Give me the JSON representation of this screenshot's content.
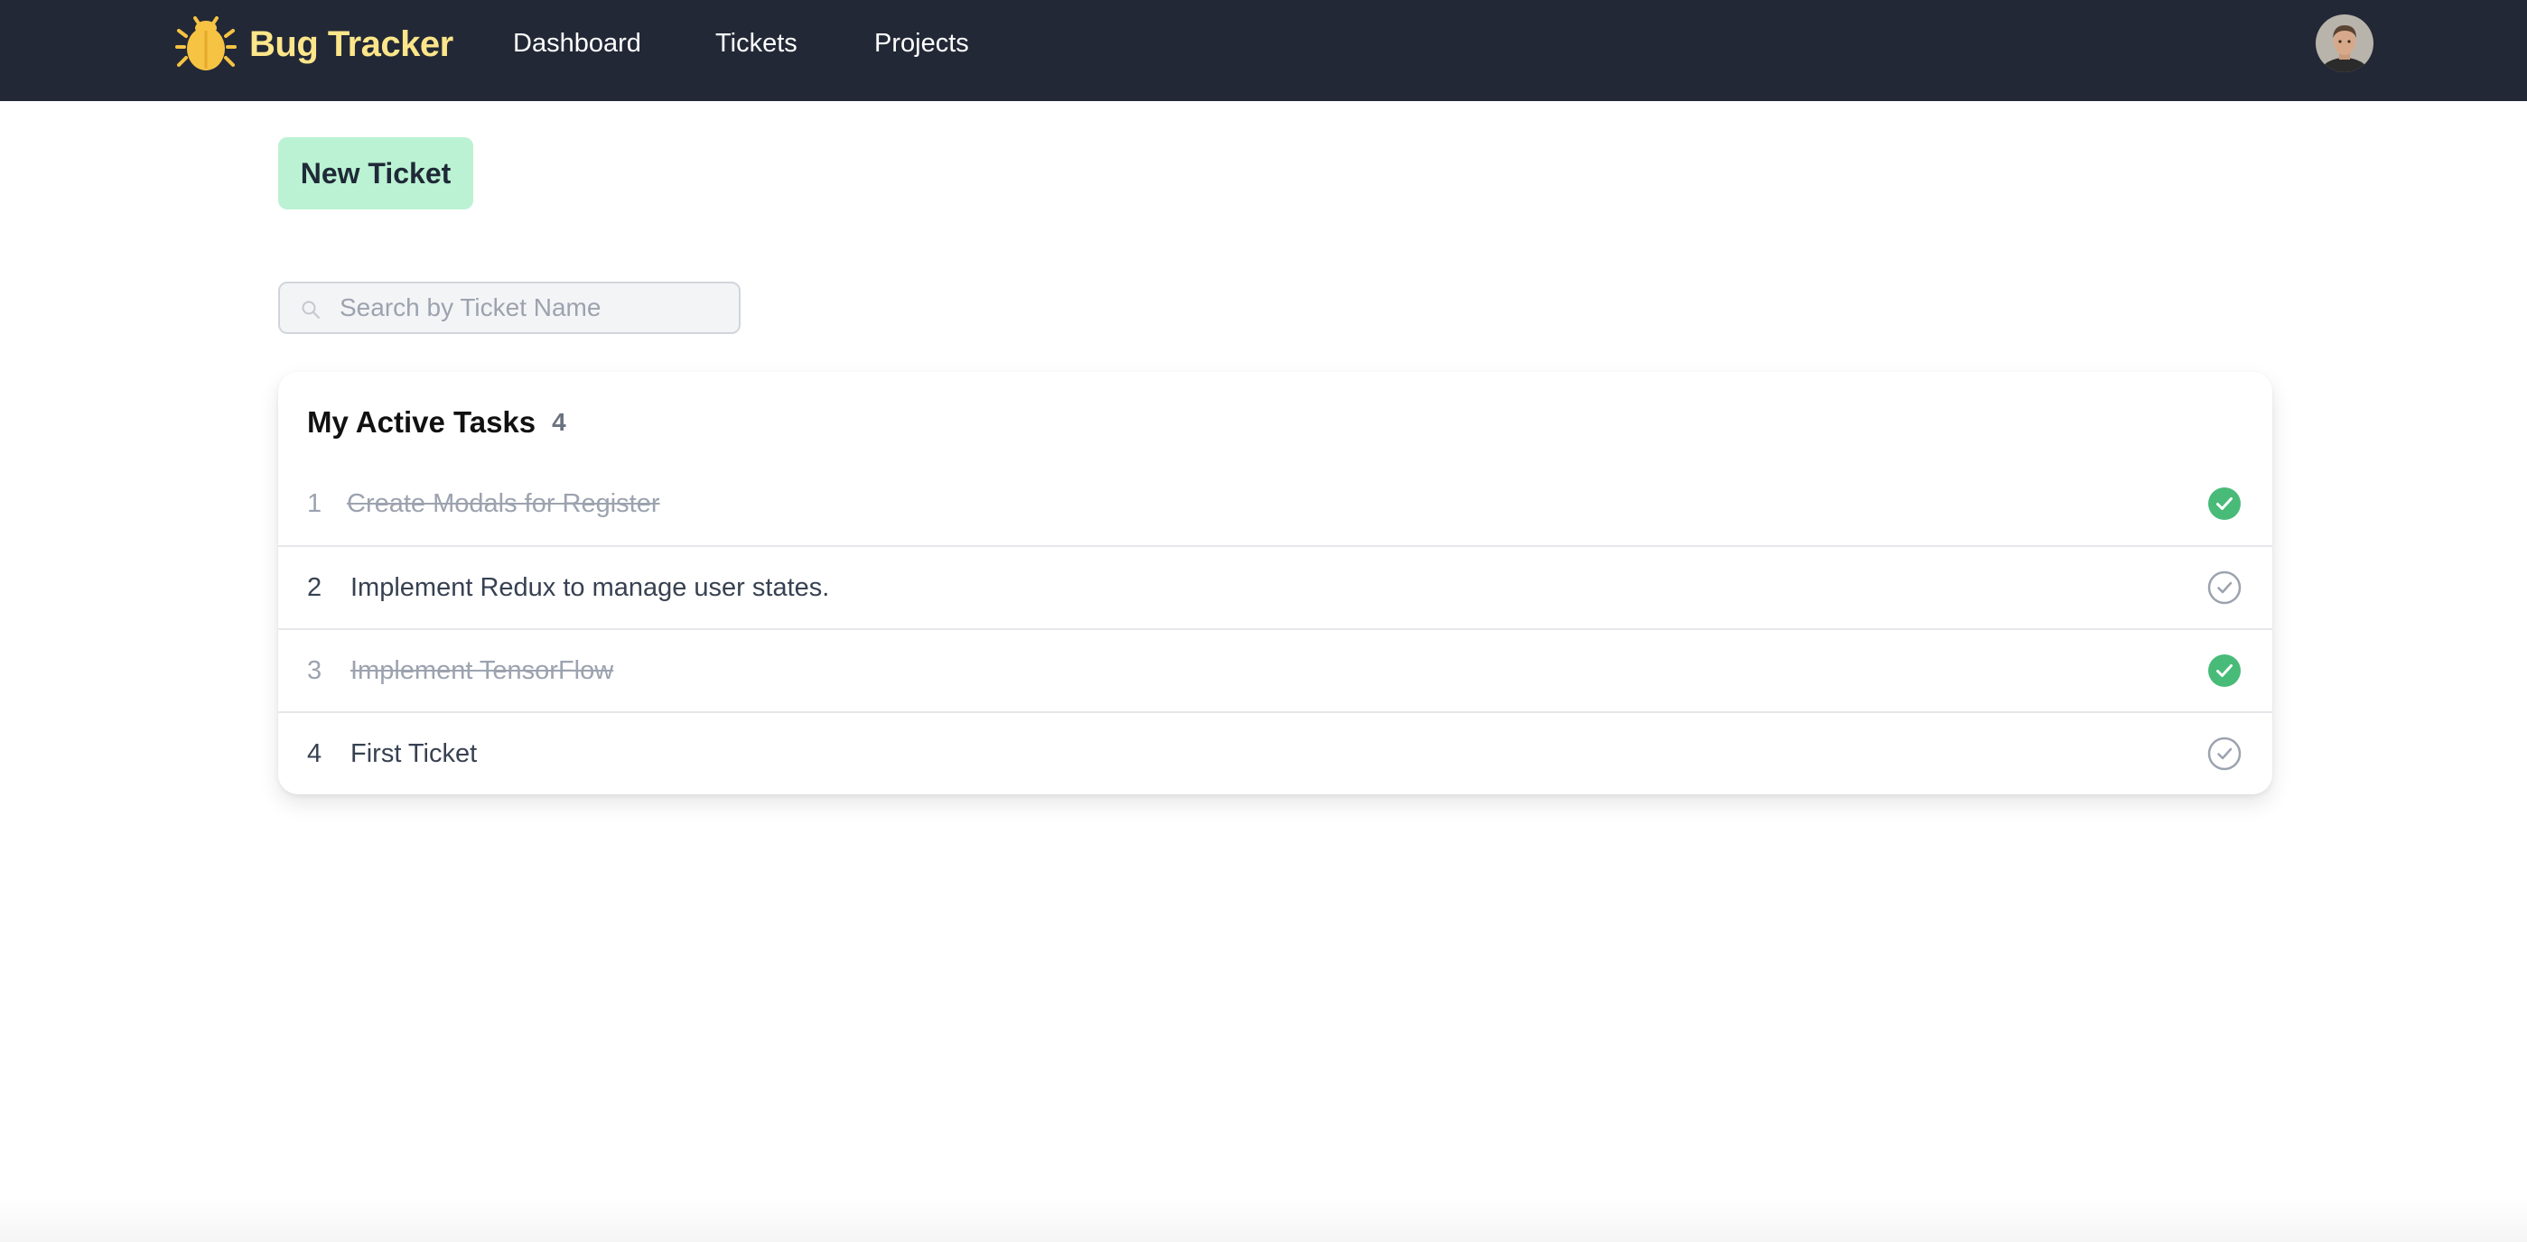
{
  "navbar": {
    "brand": "Bug Tracker",
    "brand_icon": "bug-icon",
    "links": [
      "Dashboard",
      "Tickets",
      "Projects"
    ],
    "avatar_icon": "user-avatar"
  },
  "actions": {
    "new_ticket_label": "New Ticket"
  },
  "search": {
    "placeholder": "Search by Ticket Name",
    "value": "",
    "icon": "search-icon"
  },
  "tasks": {
    "title": "My Active Tasks",
    "count": "4",
    "items": [
      {
        "number": "1",
        "name": "Create Modals for Register",
        "completed": true
      },
      {
        "number": "2",
        "name": "Implement Redux to manage user states.",
        "completed": false
      },
      {
        "number": "3",
        "name": "Implement TensorFlow",
        "completed": true
      },
      {
        "number": "4",
        "name": "First Ticket",
        "completed": false
      }
    ]
  },
  "colors": {
    "navbar_bg": "#222836",
    "brand": "#fde68a",
    "new_ticket_bg": "#bbf2d3",
    "check_done": "#48bb78",
    "check_pending": "#9ca3af"
  }
}
